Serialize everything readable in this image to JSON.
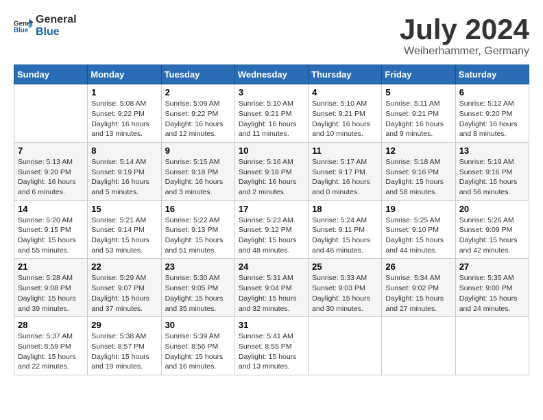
{
  "header": {
    "logo_general": "General",
    "logo_blue": "Blue",
    "title": "July 2024",
    "subtitle": "Weiherhammer, Germany"
  },
  "columns": [
    "Sunday",
    "Monday",
    "Tuesday",
    "Wednesday",
    "Thursday",
    "Friday",
    "Saturday"
  ],
  "weeks": [
    [
      {
        "day": "",
        "info": ""
      },
      {
        "day": "1",
        "info": "Sunrise: 5:08 AM\nSunset: 9:22 PM\nDaylight: 16 hours\nand 13 minutes."
      },
      {
        "day": "2",
        "info": "Sunrise: 5:09 AM\nSunset: 9:22 PM\nDaylight: 16 hours\nand 12 minutes."
      },
      {
        "day": "3",
        "info": "Sunrise: 5:10 AM\nSunset: 9:21 PM\nDaylight: 16 hours\nand 11 minutes."
      },
      {
        "day": "4",
        "info": "Sunrise: 5:10 AM\nSunset: 9:21 PM\nDaylight: 16 hours\nand 10 minutes."
      },
      {
        "day": "5",
        "info": "Sunrise: 5:11 AM\nSunset: 9:21 PM\nDaylight: 16 hours\nand 9 minutes."
      },
      {
        "day": "6",
        "info": "Sunrise: 5:12 AM\nSunset: 9:20 PM\nDaylight: 16 hours\nand 8 minutes."
      }
    ],
    [
      {
        "day": "7",
        "info": "Sunrise: 5:13 AM\nSunset: 9:20 PM\nDaylight: 16 hours\nand 6 minutes."
      },
      {
        "day": "8",
        "info": "Sunrise: 5:14 AM\nSunset: 9:19 PM\nDaylight: 16 hours\nand 5 minutes."
      },
      {
        "day": "9",
        "info": "Sunrise: 5:15 AM\nSunset: 9:18 PM\nDaylight: 16 hours\nand 3 minutes."
      },
      {
        "day": "10",
        "info": "Sunrise: 5:16 AM\nSunset: 9:18 PM\nDaylight: 16 hours\nand 2 minutes."
      },
      {
        "day": "11",
        "info": "Sunrise: 5:17 AM\nSunset: 9:17 PM\nDaylight: 16 hours\nand 0 minutes."
      },
      {
        "day": "12",
        "info": "Sunrise: 5:18 AM\nSunset: 9:16 PM\nDaylight: 15 hours\nand 58 minutes."
      },
      {
        "day": "13",
        "info": "Sunrise: 5:19 AM\nSunset: 9:16 PM\nDaylight: 15 hours\nand 56 minutes."
      }
    ],
    [
      {
        "day": "14",
        "info": "Sunrise: 5:20 AM\nSunset: 9:15 PM\nDaylight: 15 hours\nand 55 minutes."
      },
      {
        "day": "15",
        "info": "Sunrise: 5:21 AM\nSunset: 9:14 PM\nDaylight: 15 hours\nand 53 minutes."
      },
      {
        "day": "16",
        "info": "Sunrise: 5:22 AM\nSunset: 9:13 PM\nDaylight: 15 hours\nand 51 minutes."
      },
      {
        "day": "17",
        "info": "Sunrise: 5:23 AM\nSunset: 9:12 PM\nDaylight: 15 hours\nand 48 minutes."
      },
      {
        "day": "18",
        "info": "Sunrise: 5:24 AM\nSunset: 9:11 PM\nDaylight: 15 hours\nand 46 minutes."
      },
      {
        "day": "19",
        "info": "Sunrise: 5:25 AM\nSunset: 9:10 PM\nDaylight: 15 hours\nand 44 minutes."
      },
      {
        "day": "20",
        "info": "Sunrise: 5:26 AM\nSunset: 9:09 PM\nDaylight: 15 hours\nand 42 minutes."
      }
    ],
    [
      {
        "day": "21",
        "info": "Sunrise: 5:28 AM\nSunset: 9:08 PM\nDaylight: 15 hours\nand 39 minutes."
      },
      {
        "day": "22",
        "info": "Sunrise: 5:29 AM\nSunset: 9:07 PM\nDaylight: 15 hours\nand 37 minutes."
      },
      {
        "day": "23",
        "info": "Sunrise: 5:30 AM\nSunset: 9:05 PM\nDaylight: 15 hours\nand 35 minutes."
      },
      {
        "day": "24",
        "info": "Sunrise: 5:31 AM\nSunset: 9:04 PM\nDaylight: 15 hours\nand 32 minutes."
      },
      {
        "day": "25",
        "info": "Sunrise: 5:33 AM\nSunset: 9:03 PM\nDaylight: 15 hours\nand 30 minutes."
      },
      {
        "day": "26",
        "info": "Sunrise: 5:34 AM\nSunset: 9:02 PM\nDaylight: 15 hours\nand 27 minutes."
      },
      {
        "day": "27",
        "info": "Sunrise: 5:35 AM\nSunset: 9:00 PM\nDaylight: 15 hours\nand 24 minutes."
      }
    ],
    [
      {
        "day": "28",
        "info": "Sunrise: 5:37 AM\nSunset: 8:59 PM\nDaylight: 15 hours\nand 22 minutes."
      },
      {
        "day": "29",
        "info": "Sunrise: 5:38 AM\nSunset: 8:57 PM\nDaylight: 15 hours\nand 19 minutes."
      },
      {
        "day": "30",
        "info": "Sunrise: 5:39 AM\nSunset: 8:56 PM\nDaylight: 15 hours\nand 16 minutes."
      },
      {
        "day": "31",
        "info": "Sunrise: 5:41 AM\nSunset: 8:55 PM\nDaylight: 15 hours\nand 13 minutes."
      },
      {
        "day": "",
        "info": ""
      },
      {
        "day": "",
        "info": ""
      },
      {
        "day": "",
        "info": ""
      }
    ]
  ]
}
